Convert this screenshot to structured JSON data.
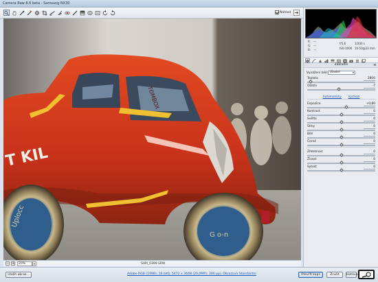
{
  "window": {
    "title": "Camera Raw 8.6 beta  -  Samsung NX30"
  },
  "toolbar": {
    "tools": [
      "zoom-tool-icon",
      "hand-tool-icon",
      "white-balance-tool-icon",
      "color-sampler-icon",
      "targeted-adjustment-icon",
      "crop-tool-icon",
      "straighten-tool-icon",
      "spot-removal-icon",
      "red-eye-icon",
      "adjustment-brush-icon",
      "graduated-filter-icon",
      "radial-filter-icon",
      "preferences-icon",
      "rotate-ccw-icon",
      "rotate-cw-icon"
    ],
    "preview_label": "Náhled",
    "preview_checked": true,
    "fullscreen_icon": "fullscreen-icon"
  },
  "image": {
    "filename": "SAM_0399.SRW"
  },
  "zoom": {
    "minus": "−",
    "plus": "+",
    "value": "20%"
  },
  "histogram": {
    "readout": {
      "r_label": "R:",
      "r_val": "---",
      "g_label": "G:",
      "g_val": "---",
      "b_label": "B:",
      "b_val": "---",
      "aperture": "f/5,6",
      "shutter": "1/200 s",
      "iso": "ISO 4000",
      "lens": "16-50@23 mm"
    }
  },
  "panel": {
    "tab_icons": [
      "basic-icon",
      "tone-curve-icon",
      "detail-icon",
      "hsl-icon",
      "split-toning-icon",
      "lens-corrections-icon",
      "effects-icon",
      "camera-calibration-icon",
      "presets-icon",
      "snapshots-icon"
    ],
    "title": "Základní",
    "wb_label": "Vyvážení bílé:",
    "wb_value": "Vlastní",
    "auto_link": "Automaticky",
    "default_link": "Výchozí",
    "sliders": [
      {
        "key": "temp",
        "label": "Teplota",
        "value": "2800",
        "pos": 0.05
      },
      {
        "key": "tint",
        "label": "Odstín",
        "value": "-7",
        "pos": 0.46
      },
      {
        "key": "exposure",
        "label": "Expozice",
        "value": "+0,80",
        "pos": 0.58
      },
      {
        "key": "contrast",
        "label": "Kontrast",
        "value": "0",
        "pos": 0.5
      },
      {
        "key": "highlights",
        "label": "Světla",
        "value": "0",
        "pos": 0.5
      },
      {
        "key": "shadows",
        "label": "Stíny",
        "value": "0",
        "pos": 0.5
      },
      {
        "key": "whites",
        "label": "Bílé",
        "value": "0",
        "pos": 0.5
      },
      {
        "key": "blacks",
        "label": "Černé",
        "value": "0",
        "pos": 0.5
      },
      {
        "key": "clarity",
        "label": "Zřetelnost",
        "value": "0",
        "pos": 0.5
      },
      {
        "key": "vibrance",
        "label": "Živost",
        "value": "0",
        "pos": 0.5
      },
      {
        "key": "saturation",
        "label": "Sytost",
        "value": "0",
        "pos": 0.5
      }
    ]
  },
  "status": {
    "save_button": "Uložit obraz...",
    "workflow_link": "Adobe RGB (1998); 16 bitů; 5472 x 3648 (20,0MP); 300 ppi; Obrazová Standardní",
    "open_button": "Otevřít kopii",
    "cancel_button": "Zrušit",
    "done_button": "Hotovo"
  }
}
